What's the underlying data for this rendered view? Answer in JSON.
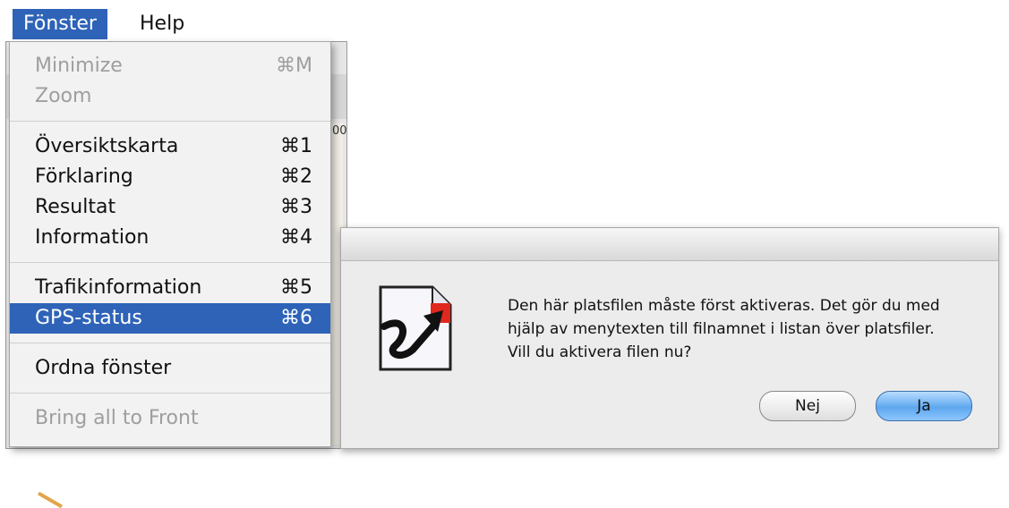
{
  "menubar": {
    "active_menu": "Fönster",
    "help_menu": "Help"
  },
  "background_window": {
    "map_label": "00"
  },
  "menu": {
    "items": [
      {
        "label": "Minimize",
        "shortcut": "⌘M",
        "enabled": false
      },
      {
        "label": "Zoom",
        "shortcut": "",
        "enabled": false
      },
      {
        "label": "Översiktskarta",
        "shortcut": "⌘1",
        "enabled": true
      },
      {
        "label": "Förklaring",
        "shortcut": "⌘2",
        "enabled": true
      },
      {
        "label": "Resultat",
        "shortcut": "⌘3",
        "enabled": true
      },
      {
        "label": "Information",
        "shortcut": "⌘4",
        "enabled": true
      },
      {
        "label": "Trafikinformation",
        "shortcut": "⌘5",
        "enabled": true
      },
      {
        "label": "GPS-status",
        "shortcut": "⌘6",
        "enabled": true,
        "selected": true
      },
      {
        "label": "Ordna fönster",
        "shortcut": "",
        "enabled": true
      },
      {
        "label": "Bring all to Front",
        "shortcut": "",
        "enabled": false
      }
    ]
  },
  "dialog": {
    "icon": "map-file-arrow-icon",
    "message": "Den här platsfilen måste först aktiveras. Det gör du med hjälp av menytexten till filnamnet i listan över platsfiler. Vill du aktivera filen nu?",
    "no_button": "Nej",
    "yes_button": "Ja"
  },
  "colors": {
    "selection": "#2e63b8",
    "default_button": "#5ea7ee",
    "dialog_background": "#ececec"
  }
}
